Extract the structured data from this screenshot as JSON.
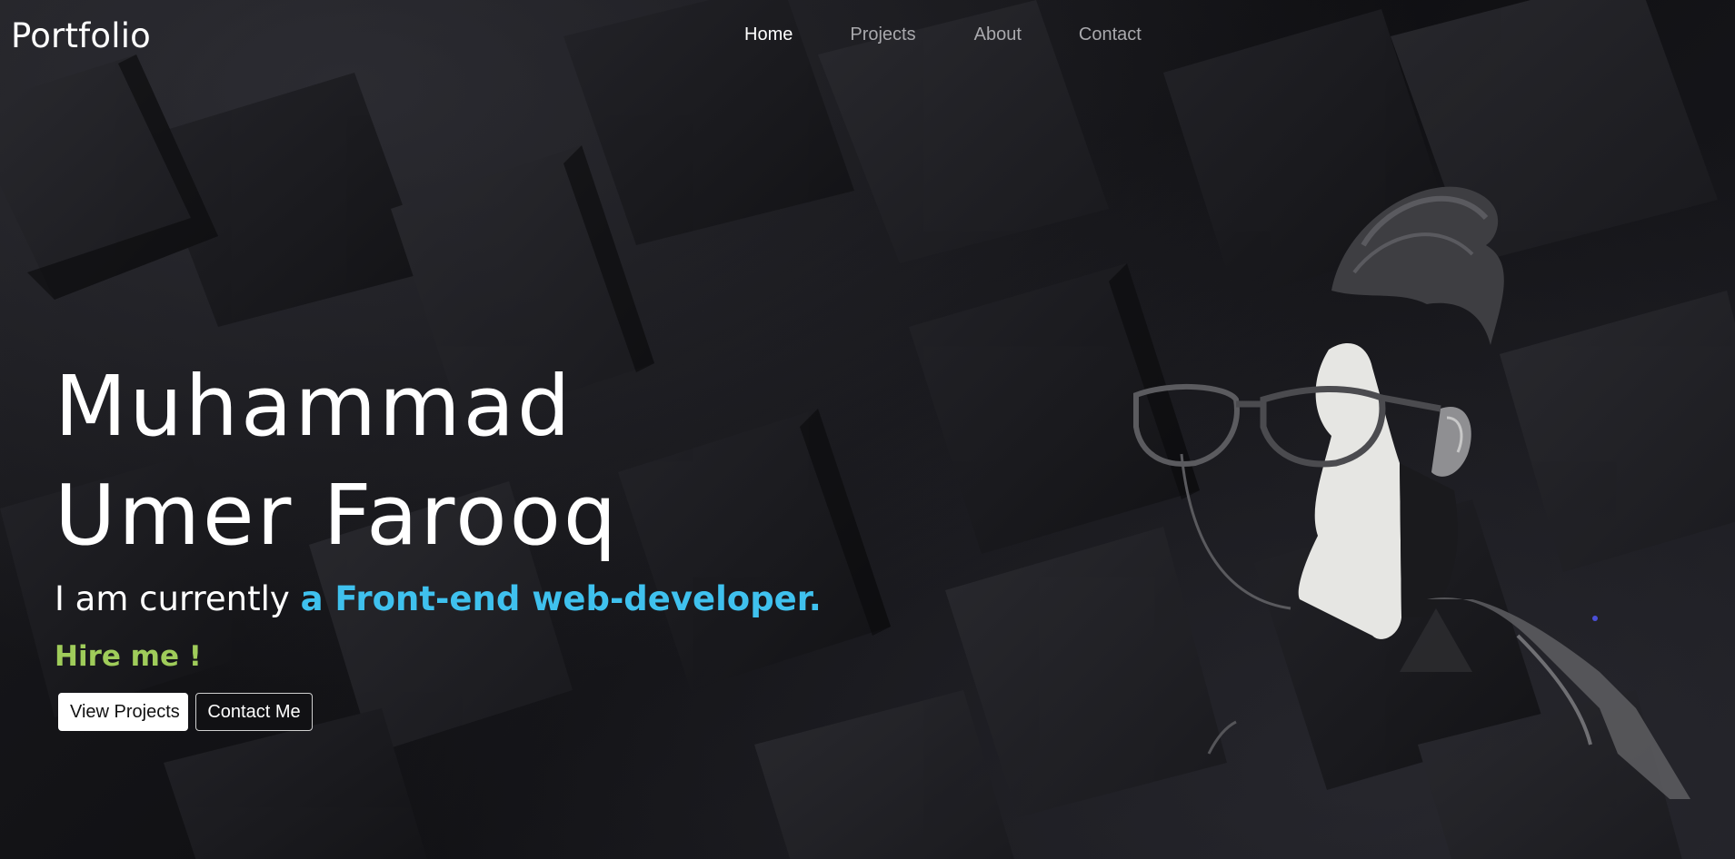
{
  "header": {
    "brand": "Portfolio",
    "nav": [
      {
        "label": "Home",
        "active": true
      },
      {
        "label": "Projects",
        "active": false
      },
      {
        "label": "About",
        "active": false
      },
      {
        "label": "Contact",
        "active": false
      }
    ]
  },
  "hero": {
    "name_line1": "Muhammad",
    "name_line2": "Umer Farooq",
    "tagline_prefix": "I am currently",
    "tagline_accent": "a Front-end web-developer.",
    "hire": "Hire me !",
    "buttons": {
      "view_projects": "View Projects",
      "contact_me": "Contact Me"
    }
  },
  "colors": {
    "accent": "#3fc1ee",
    "hire": "#9fcc5a",
    "background": "#141417"
  },
  "icons": {
    "portrait": "avatar-illustration-icon"
  }
}
